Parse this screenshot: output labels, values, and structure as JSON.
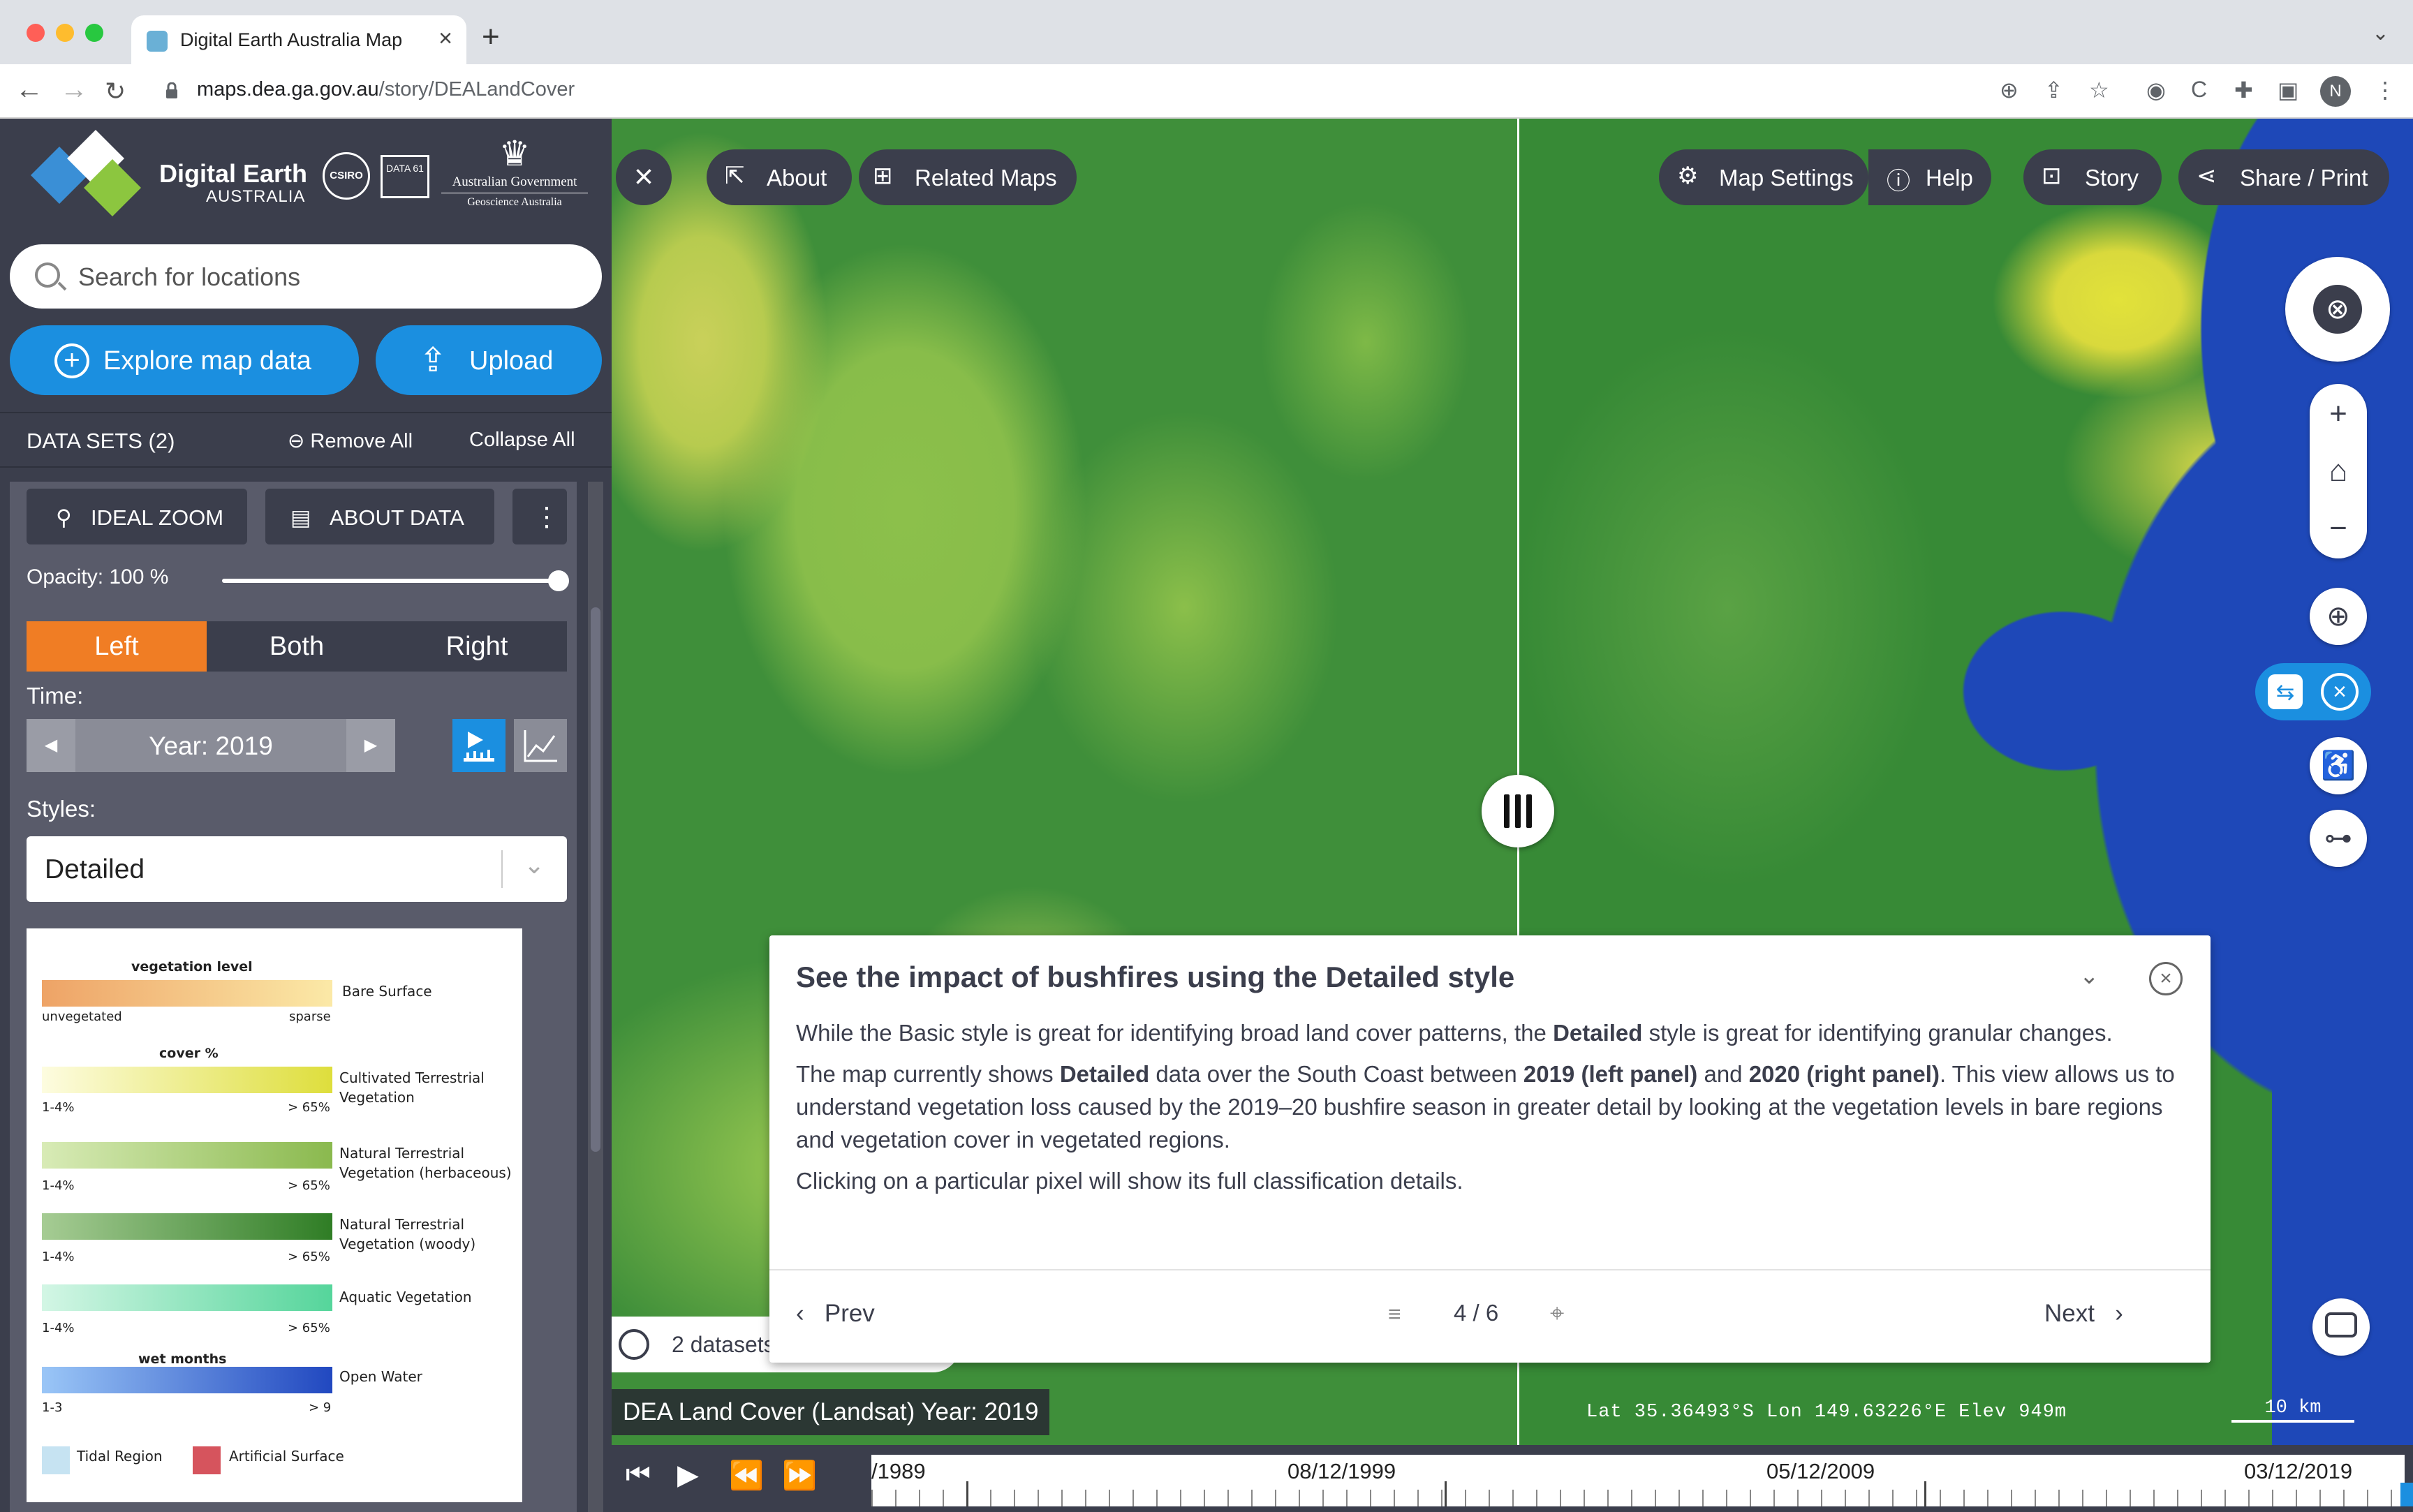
{
  "browser": {
    "tab_title": "Digital Earth Australia Map",
    "url_host": "maps.dea.ga.gov.au",
    "url_path": "/story/DEALandCover",
    "profile_initial": "N"
  },
  "brand": {
    "title": "Digital Earth",
    "subtitle": "AUSTRALIA",
    "csiro": "CSIRO",
    "data61": "DATA 61",
    "govt_line1": "Australian Government",
    "govt_line2": "Geoscience Australia"
  },
  "sidebar": {
    "search_placeholder": "Search for locations",
    "explore_label": "Explore map data",
    "upload_label": "Upload",
    "datasets_title": "DATA SETS (2)",
    "remove_all": "Remove All",
    "collapse_all": "Collapse All",
    "ideal_zoom": "IDEAL ZOOM",
    "about_data": "ABOUT DATA",
    "opacity_label": "Opacity: 100 %",
    "opacity_value": 1.0,
    "split_left": "Left",
    "split_both": "Both",
    "split_right": "Right",
    "split_active": "Left",
    "time_label": "Time:",
    "time_value": "Year: 2019",
    "styles_label": "Styles:",
    "style_value": "Detailed"
  },
  "legend": {
    "h_vegetation_level": "vegetation level",
    "bare_surface": "Bare Surface",
    "unvegetated": "unvegetated",
    "sparse": "sparse",
    "h_cover": "cover %",
    "cultivated": "Cultivated Terrestrial Vegetation",
    "natural_herb": "Natural Terrestrial Vegetation (herbaceous)",
    "natural_woody": "Natural Terrestrial Vegetation (woody)",
    "aquatic": "Aquatic Vegetation",
    "range_low": "1-4%",
    "range_high": "> 65%",
    "h_wet_months": "wet months",
    "open_water": "Open Water",
    "water_low": "1-3",
    "water_high": "> 9",
    "tidal": "Tidal Region",
    "artificial": "Artificial Surface",
    "colors": {
      "bare_from": "#eea366",
      "bare_to": "#fbe9a7",
      "cult_from": "#fdfce0",
      "cult_to": "#dede3c",
      "herb_from": "#d8ebb6",
      "herb_to": "#8ab94e",
      "woody_from": "#a6cc94",
      "woody_to": "#2f7d25",
      "aqua_from": "#d3f6e5",
      "aqua_to": "#55d59b",
      "water_from": "#9ac6f7",
      "water_to": "#2148c0",
      "tidal": "#c6e3f2",
      "artificial": "#d6545d"
    }
  },
  "map": {
    "about": "About",
    "related_maps": "Related Maps",
    "map_settings": "Map Settings",
    "help": "Help",
    "story": "Story",
    "share_print": "Share / Print",
    "datasets_chip": "2 datasets",
    "layer_label": "DEA Land Cover (Landsat) Year: 2019",
    "coords": "Lat  35.36493°S   Lon  149.63226°E  Elev  949m",
    "scale": "10 km"
  },
  "story": {
    "title": "See the impact of bushfires using the Detailed style",
    "p1_a": "While the Basic style is great for identifying broad land cover patterns, the ",
    "p1_b": "Detailed",
    "p1_c": " style is great for identifying granular changes.",
    "p2_a": "The map currently shows ",
    "p2_b": "Detailed",
    "p2_c": " data over the South Coast between ",
    "p2_d": "2019 (left panel)",
    "p2_e": " and ",
    "p2_f": "2020 (right panel)",
    "p2_g": ". This view allows us to understand vegetation loss caused by the 2019–20 bushfire season in greater detail by looking at the vegetation levels in bare regions and vegetation cover in vegetated regions.",
    "p3": "Clicking on a particular pixel will show its full classification details.",
    "prev": "Prev",
    "page": "4 / 6",
    "next": "Next"
  },
  "timeline": {
    "dates": [
      "/1989",
      "08/12/1999",
      "05/12/2009",
      "03/12/2019"
    ]
  }
}
